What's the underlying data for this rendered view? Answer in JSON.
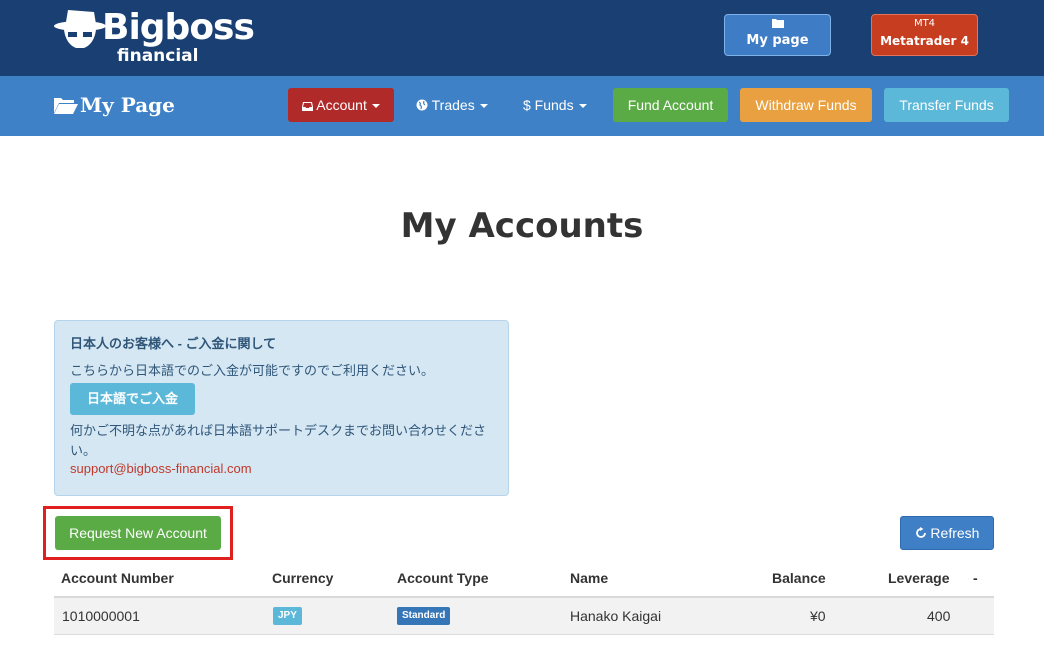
{
  "header": {
    "logo_text": "Bigboss",
    "logo_sub": "financial",
    "mypage_button": "My page",
    "mt4_small": "MT4",
    "mt4_button": "Metatrader 4"
  },
  "nav": {
    "brand": "My Page",
    "account": "Account",
    "trades": "Trades",
    "funds": "$ Funds",
    "fund_account": "Fund Account",
    "withdraw_funds": "Withdraw Funds",
    "transfer_funds": "Transfer Funds"
  },
  "page_title": "My Accounts",
  "notice": {
    "title": "日本人のお客様へ - ご入金に関して",
    "line1": "こちらから日本語でのご入金が可能ですのでご利用ください。",
    "button": "日本語でご入金",
    "line2": "何かご不明な点があれば日本語サポートデスクまでお問い合わせください。",
    "email": "support@bigboss-financial.com"
  },
  "actions": {
    "request_new_account": "Request New Account",
    "refresh": "Refresh"
  },
  "table": {
    "headers": {
      "account_number": "Account Number",
      "currency": "Currency",
      "account_type": "Account Type",
      "name": "Name",
      "balance": "Balance",
      "leverage": "Leverage",
      "extra": "-"
    },
    "rows": [
      {
        "account_number": "1010000001",
        "currency": "JPY",
        "account_type": "Standard",
        "name": "Hanako Kaigai",
        "balance": "¥0",
        "leverage": "400"
      }
    ]
  },
  "colors": {
    "header_bg": "#1a3f73",
    "nav_bg": "#3e81c6",
    "account_btn": "#b02a2a",
    "green": "#5aaa45",
    "orange": "#e8a040",
    "light_blue": "#5bb8d8",
    "highlight": "#e0201e"
  }
}
